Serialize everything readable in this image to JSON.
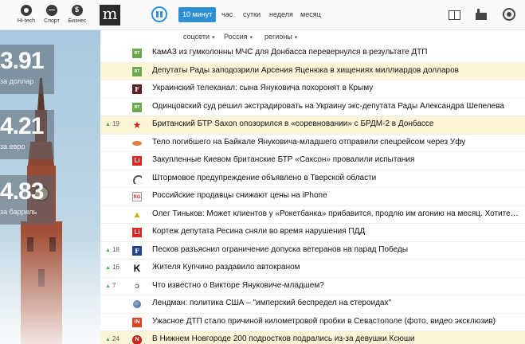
{
  "topbar": {
    "categories": [
      {
        "label": "Hi-tech",
        "icon": "chrome-icon"
      },
      {
        "label": "Спорт",
        "icon": "basketball-icon"
      },
      {
        "label": "Бизнес",
        "icon": "dollar-icon"
      }
    ],
    "logo": "m",
    "periods": [
      {
        "label": "10 минут",
        "active": true
      },
      {
        "label": "час",
        "active": false
      },
      {
        "label": "сутки",
        "active": false
      },
      {
        "label": "неделя",
        "active": false
      },
      {
        "label": "месяц",
        "active": false
      }
    ],
    "right_icons": [
      "books-icon",
      "factory-icon",
      "globe-icon"
    ],
    "accent_color": "#2d8fd6"
  },
  "rates": [
    {
      "value": "3.91",
      "label": "за доллар"
    },
    {
      "value": "4.21",
      "label": "за евро"
    },
    {
      "value": "4.83",
      "label": "за баррель"
    }
  ],
  "filters": [
    {
      "label": "соцсети"
    },
    {
      "label": "Россия"
    },
    {
      "label": "регионы"
    }
  ],
  "feed": [
    {
      "votes": "",
      "source_icon": "rt-icon",
      "source_glyph": "RT",
      "title": "КамАЗ из гумколонны МЧС для Донбасса перевернулся в результате ДТП",
      "highlight": false
    },
    {
      "votes": "",
      "source_icon": "rt-icon",
      "source_glyph": "RT",
      "title": "Депутаты Рады заподозрили Арсения Яценюка в хищениях миллиардов долларов",
      "highlight": true
    },
    {
      "votes": "",
      "source_icon": "f-logo-icon",
      "source_glyph": "F",
      "title": "Украинский телеканал: сына Януковича похоронят в Крыму",
      "highlight": false
    },
    {
      "votes": "",
      "source_icon": "rt-icon",
      "source_glyph": "RT",
      "title": "Одинцовский суд решил экстрадировать на Украину экс-депутата Рады Александра Шепелева",
      "highlight": false
    },
    {
      "votes": "19",
      "source_icon": "red-star-icon",
      "source_glyph": "★",
      "title": "Британский БТР Saxon опозорился в «соревновании» с БРДМ-2 в Донбассе",
      "highlight": true
    },
    {
      "votes": "",
      "source_icon": "oval-logo-icon",
      "source_glyph": "",
      "title": "Тело погибшего на Байкале Януковича-младшего отправили спецрейсом через Уфу",
      "highlight": false
    },
    {
      "votes": "",
      "source_icon": "li-logo-icon",
      "source_glyph": "Li",
      "title": "Закупленные Киевом британские БТР «Саксон» провалили испытания",
      "highlight": false
    },
    {
      "votes": "",
      "source_icon": "swirl-logo-icon",
      "source_glyph": "",
      "title": "Штормовое предупреждение объявлено в Тверской области",
      "highlight": false
    },
    {
      "votes": "",
      "source_icon": "rg-logo-icon",
      "source_glyph": "RG",
      "title": "Российские продавцы снижают цены на iPhone",
      "highlight": false
    },
    {
      "votes": "",
      "source_icon": "triangle-logo-icon",
      "source_glyph": "▲",
      "title": "Олег Тиньков: Может клиентов у «Рокетбанка» прибавится, продлю им агонию на месяц. Хотите, прибавлю",
      "highlight": false
    },
    {
      "votes": "",
      "source_icon": "li-logo-icon",
      "source_glyph": "Li",
      "title": "Кортеж депутата Ресина сняли во время нарушения ПДД",
      "highlight": false
    },
    {
      "votes": "18",
      "source_icon": "fontanka-logo-icon",
      "source_glyph": "F",
      "title": "Песков разъяснил ограничение допуска ветеранов на парад Победы",
      "highlight": false
    },
    {
      "votes": "16",
      "source_icon": "k-logo-icon",
      "source_glyph": "K",
      "title": "Жителя Купчино раздавило автокраном",
      "highlight": false
    },
    {
      "votes": "7",
      "source_icon": "wing-logo-icon",
      "source_glyph": "ↄ",
      "title": "Что известно о Викторе Януковиче-младшем?",
      "highlight": false
    },
    {
      "votes": "",
      "source_icon": "globe-logo-icon",
      "source_glyph": "",
      "title": "Лендман: политика США – \"имперский беспредел на стероидах\"",
      "highlight": false
    },
    {
      "votes": "",
      "source_icon": "in-logo-icon",
      "source_glyph": "IN",
      "title": "Ужасное ДТП стало причиной километровой пробки в Севастополе (фото, видео эксклюзив)",
      "highlight": false
    },
    {
      "votes": "24",
      "source_icon": "circle-logo-icon",
      "source_glyph": "N",
      "title": "В Нижнем Новгороде 200 подростков подрались из-за девушки Ксюши",
      "highlight": true
    }
  ]
}
